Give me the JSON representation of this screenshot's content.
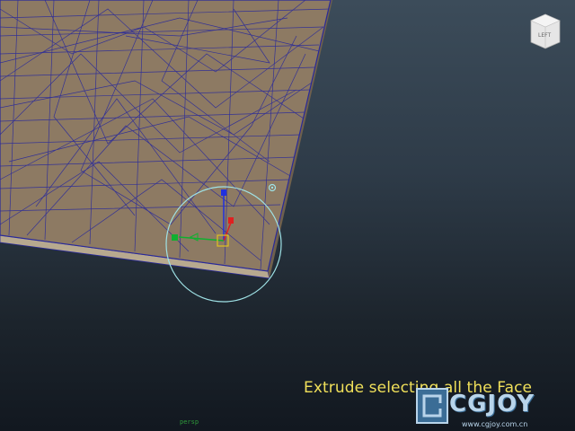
{
  "viewport": {
    "caption": "Extrude selecting all the Face",
    "status_text": "persp",
    "view_cube_label": "LEFT"
  },
  "watermark": {
    "brand": "CGJOY",
    "url": "www.cgjoy.com.cn"
  },
  "colors": {
    "surface": "#8d7a63",
    "wireframe": "#2a2a9a",
    "caption": "#f0e05a",
    "x_axis": "#e02020",
    "y_axis": "#2030e0",
    "z_axis": "#10b030",
    "soft_selection": "#9fe2e6"
  },
  "icons": [
    "view-cube-icon",
    "move-manipulator-icon",
    "rotate-handle-icon",
    "cgjoy-logo-icon"
  ]
}
